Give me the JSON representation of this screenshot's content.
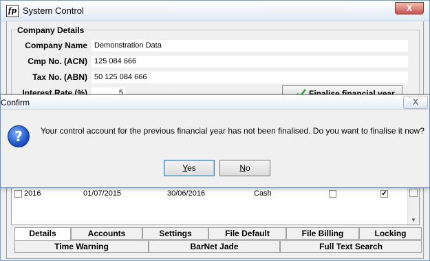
{
  "window": {
    "title": "System Control",
    "icon_glyph": "fp",
    "close_glyph": "X"
  },
  "company": {
    "group_title": "Company Details",
    "fields": [
      {
        "label": "Company Name",
        "value": "Demonstration Data"
      },
      {
        "label": "Cmp No. (ACN)",
        "value": "125 084 666"
      },
      {
        "label": "Tax No. (ABN)",
        "value": "50 125 084 666"
      },
      {
        "label": "Interest Rate (%)",
        "value": "5"
      }
    ],
    "finalise_label": "Finalise financial year"
  },
  "grid": {
    "row": {
      "year": "2016",
      "start": "01/07/2015",
      "end": "30/06/2016",
      "method": "Cash",
      "check1": "",
      "check2": "✔"
    }
  },
  "tabs": {
    "row1": [
      "Details",
      "Accounts",
      "Settings",
      "File Default",
      "File Billing",
      "Locking"
    ],
    "row2": [
      "Time Warning",
      "BarNet Jade",
      "Full Text Search"
    ],
    "active": "Details"
  },
  "dialog": {
    "title": "Confirm",
    "close_glyph": "X",
    "icon_glyph": "?",
    "message": "Your control account for the previous financial year has not been finalised. Do you want to finalise it now?",
    "yes_accel": "Y",
    "yes_rest": "es",
    "no_accel": "N",
    "no_rest": "o"
  }
}
